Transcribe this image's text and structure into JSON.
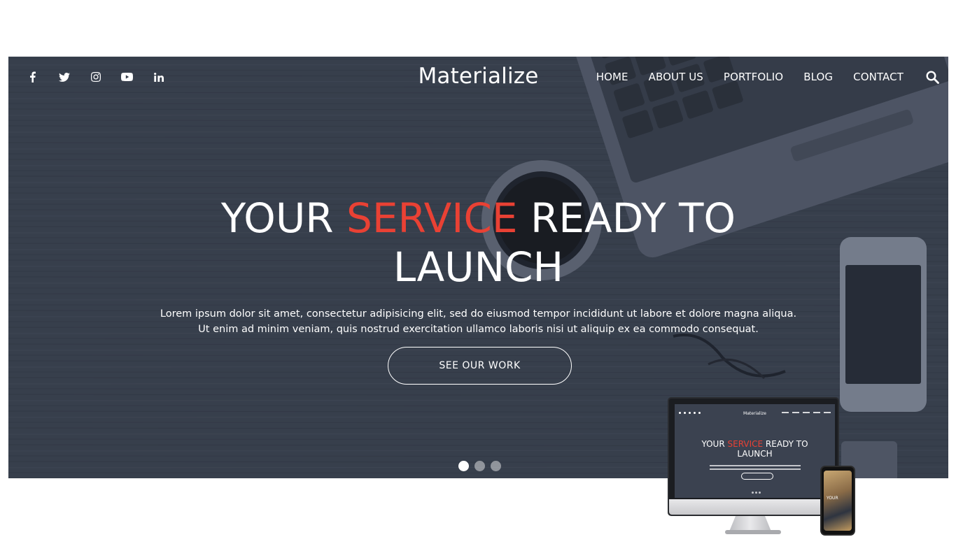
{
  "header": {
    "brand": "Materialize",
    "social_icons": [
      "facebook-icon",
      "twitter-icon",
      "instagram-icon",
      "youtube-icon",
      "linkedin-icon"
    ],
    "nav": [
      {
        "label": "HOME"
      },
      {
        "label": "ABOUT US"
      },
      {
        "label": "PORTFOLIO"
      },
      {
        "label": "BLOG"
      },
      {
        "label": "CONTACT"
      }
    ],
    "search_icon": "search-icon"
  },
  "hero": {
    "headline_part1": "YOUR ",
    "headline_accent": "SERVICE",
    "headline_part2": " READY TO",
    "headline_line2": "LAUNCH",
    "subtext_line1": "Lorem ipsum dolor sit amet, consectetur adipisicing elit, sed do eiusmod tempor incididunt ut labore et dolore magna aliqua.",
    "subtext_line2": "Ut enim ad minim veniam, quis nostrud exercitation ullamco laboris nisi ut aliquip ex ea commodo consequat.",
    "cta_label": "SEE OUR WORK",
    "slides_count": 3,
    "active_slide": 1
  },
  "mockup": {
    "mini_brand": "Materialize",
    "mini_headline_part1": "YOUR ",
    "mini_headline_accent": "SERVICE",
    "mini_headline_part2": " READY TO",
    "mini_headline_line2": "LAUNCH",
    "phone_text": "YOUR"
  },
  "colors": {
    "accent": "#e94134",
    "hero_bg": "#3c4350",
    "text": "#ffffff"
  }
}
